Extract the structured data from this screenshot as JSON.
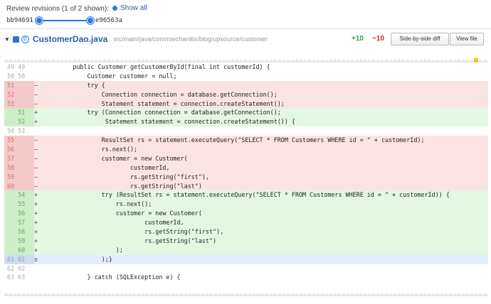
{
  "revisions": {
    "title": "Review revisions (1 of 2 shown):",
    "show_all": "Show all",
    "from": "bb94691",
    "to": "e96563a"
  },
  "file": {
    "name": "CustomerDao.java",
    "path": "src/main/java/com/mechanitis/blog/upsource/customer",
    "added": "+10",
    "removed": "−10",
    "btn_side_by_side": "Side-by-side diff",
    "btn_view_file": "View file"
  },
  "colors": {
    "accent": "#2a7ae2",
    "added": "#3a9a3a",
    "removed": "#c62828",
    "marker": "#f2c71b"
  },
  "lines": [
    {
      "type": "ctx",
      "ln": "49 49",
      "mk": "",
      "code": "        public Customer getCustomerById(final int customerId) {"
    },
    {
      "type": "ctx",
      "ln": "50 50",
      "mk": "",
      "code": "            Customer customer = null;"
    },
    {
      "type": "del",
      "ln": "51",
      "mk": "−",
      "code": "            try {"
    },
    {
      "type": "del",
      "ln": "52",
      "mk": "−",
      "code": "                Connection connection = database.getConnection();"
    },
    {
      "type": "del",
      "ln": "53",
      "mk": "−",
      "code": "                Statement statement = connection.createStatement();"
    },
    {
      "type": "add",
      "ln": "   51",
      "mk": "+",
      "code": "            try (Connection connection = database.getConnection();"
    },
    {
      "type": "add",
      "ln": "   52",
      "mk": "+",
      "code": "                 Statement statement = connection.createStatement()) {"
    },
    {
      "type": "ctx",
      "ln": "54 53",
      "mk": "",
      "code": ""
    },
    {
      "type": "del",
      "ln": "55",
      "mk": "−",
      "code": "                ResultSet rs = statement.executeQuery(\"SELECT * FROM Customers WHERE id = \" + customerId);"
    },
    {
      "type": "del",
      "ln": "56",
      "mk": "−",
      "code": "                rs.next();"
    },
    {
      "type": "del",
      "ln": "57",
      "mk": "−",
      "code": "                customer = new Customer("
    },
    {
      "type": "del",
      "ln": "58",
      "mk": "−",
      "code": "                        customerId,"
    },
    {
      "type": "del",
      "ln": "59",
      "mk": "−",
      "code": "                        rs.getString(\"first\"),"
    },
    {
      "type": "del",
      "ln": "60",
      "mk": "−",
      "code": "                        rs.getString(\"last\")"
    },
    {
      "type": "add",
      "ln": "   54",
      "mk": "+",
      "code": "                try (ResultSet rs = statement.executeQuery(\"SELECT * FROM Customers WHERE id = \" + customerId)) {"
    },
    {
      "type": "add",
      "ln": "   55",
      "mk": "+",
      "code": "                    rs.next();"
    },
    {
      "type": "add",
      "ln": "   56",
      "mk": "+",
      "code": "                    customer = new Customer("
    },
    {
      "type": "add",
      "ln": "   57",
      "mk": "+",
      "code": "                            customerId,"
    },
    {
      "type": "add",
      "ln": "   58",
      "mk": "+",
      "code": "                            rs.getString(\"first\"),"
    },
    {
      "type": "add",
      "ln": "   59",
      "mk": "+",
      "code": "                            rs.getString(\"last\")"
    },
    {
      "type": "add",
      "ln": "   60",
      "mk": "+",
      "code": "                    );"
    },
    {
      "type": "mod",
      "ln": "61 61",
      "mk": "±",
      "code": "                );}"
    },
    {
      "type": "ctx",
      "ln": "62 62",
      "mk": "",
      "code": ""
    },
    {
      "type": "ctx",
      "ln": "63 63",
      "mk": "",
      "code": "            } catch (SQLException e) {"
    }
  ]
}
